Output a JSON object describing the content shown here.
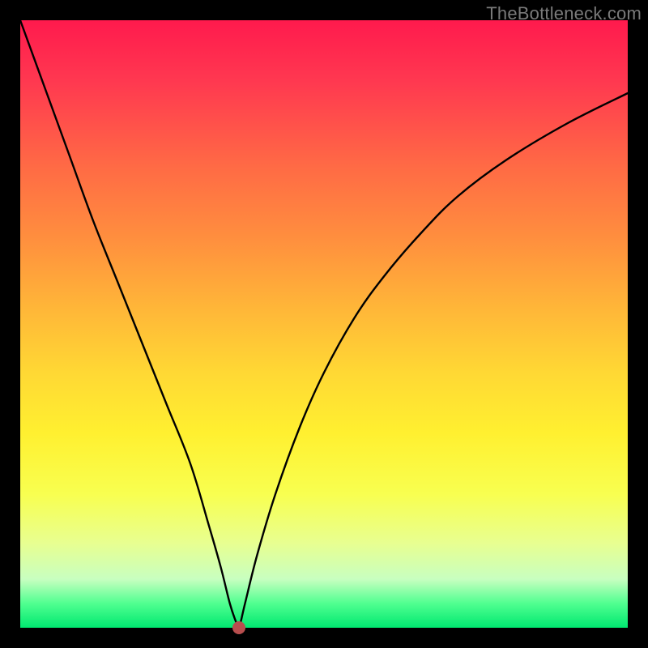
{
  "watermark": "TheBottleneck.com",
  "dot": {
    "color": "#b84e4e",
    "radius": 8
  },
  "chart_data": {
    "type": "line",
    "title": "",
    "xlabel": "",
    "ylabel": "",
    "xlim": [
      0,
      100
    ],
    "ylim": [
      0,
      100
    ],
    "minimum_x": 36,
    "series": [
      {
        "name": "bottleneck-curve",
        "x": [
          0,
          4,
          8,
          12,
          16,
          20,
          24,
          28,
          31,
          33,
          34.5,
          35.5,
          36,
          37,
          39,
          42,
          46,
          50,
          55,
          60,
          66,
          72,
          80,
          90,
          100
        ],
        "values": [
          100,
          89,
          78,
          67,
          57,
          47,
          37,
          27,
          17,
          10,
          4,
          1,
          0,
          4,
          12,
          22,
          33,
          42,
          51,
          58,
          65,
          71,
          77,
          83,
          88
        ]
      }
    ],
    "annotations": [
      {
        "type": "dot",
        "x": 36,
        "y": 0
      }
    ]
  }
}
